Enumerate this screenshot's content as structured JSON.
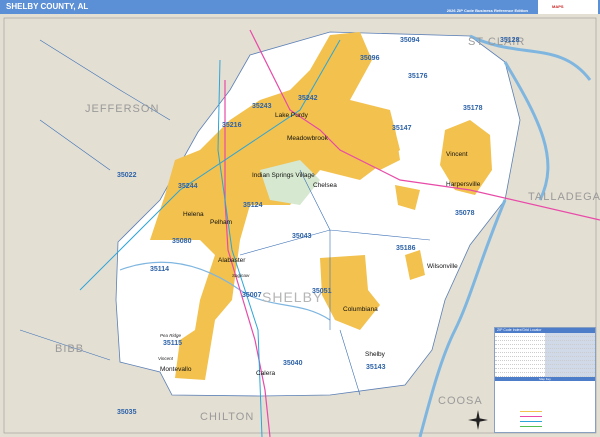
{
  "header": {
    "title": "SHELBY COUNTY, AL",
    "edition": "2026 ZIP Code Business Reference Edition",
    "logo_text": "MAPS"
  },
  "neighbor_counties": [
    "JEFFERSON",
    "ST CLAIR",
    "TALLADEGA",
    "BIBB",
    "CHILTON",
    "COOSA"
  ],
  "county_label": "SHELBY",
  "zip_codes": [
    "35094",
    "35128",
    "35176",
    "35242",
    "35243",
    "35216",
    "35147",
    "35178",
    "35022",
    "35244",
    "35124",
    "35080",
    "35043",
    "35078",
    "35186",
    "35114",
    "35007",
    "35051",
    "35115",
    "35040",
    "35143",
    "35035",
    "35096"
  ],
  "cities": [
    "Lake Purdy",
    "Meadowbrook",
    "Indian Springs Village",
    "Chelsea",
    "Vincent",
    "Harpersville",
    "Helena",
    "Pelham",
    "Alabaster",
    "Wilsonville",
    "Columbiana",
    "Montevallo",
    "Calera",
    "Shelby"
  ],
  "small_places": [
    "Saginaw",
    "Pea Ridge",
    "Vincent"
  ],
  "legend": {
    "title": "ZIP Code Index/Grid Locator",
    "map_key_title": "Map Key"
  },
  "colors": {
    "urban": "#f2c14e",
    "land": "#ffffff",
    "outside": "#e4dfd3",
    "water": "#7fb6e0",
    "zip_line": "#3a6fb5",
    "interstate": "#e84aa8",
    "highway": "#2ea5d8"
  }
}
